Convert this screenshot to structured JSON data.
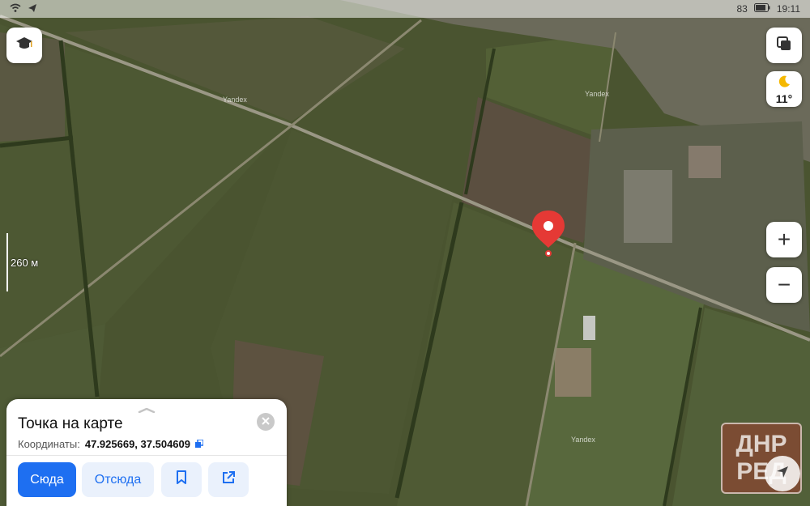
{
  "status_bar": {
    "battery": "83",
    "time": "19:11"
  },
  "map": {
    "scale_label": "260 м",
    "weather_temp": "11°",
    "zoom_in_symbol": "+",
    "zoom_out_symbol": "−",
    "watermarks": [
      "Yandex",
      "Yandex",
      "Yandex"
    ],
    "icons": [
      "education-icon",
      "layers-icon",
      "moon-icon",
      "location-pin-icon",
      "navigation-icon"
    ],
    "pin_color": "#e53935"
  },
  "card": {
    "title": "Точка на карте",
    "coords_label": "Координаты:",
    "coords_value": "47.925669, 37.504609",
    "here_label": "Сюда",
    "from_label": "Отсюда",
    "accent": "#1e6ff1"
  },
  "overlay": {
    "logo_top": "ДНР",
    "logo_bottom": "РЕД"
  }
}
